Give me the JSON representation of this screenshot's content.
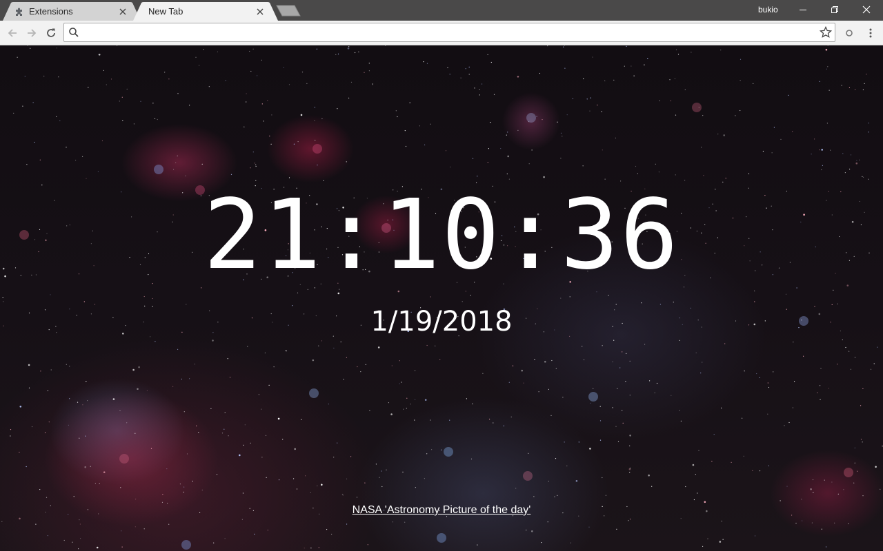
{
  "tabs": [
    {
      "title": "Extensions",
      "icon": "puzzle-icon",
      "active": false
    },
    {
      "title": "New Tab",
      "icon": null,
      "active": true
    }
  ],
  "profile": {
    "name": "bukio"
  },
  "omnibox": {
    "value": "",
    "placeholder": ""
  },
  "clock": {
    "time": "21:10:36",
    "date": "1/19/2018"
  },
  "credit": {
    "link_text": "NASA 'Astronomy Picture of the day'"
  },
  "colors": {
    "tabstrip": "#4a4949",
    "toolbar": "#f2f2f2",
    "text": "#ffffff"
  }
}
